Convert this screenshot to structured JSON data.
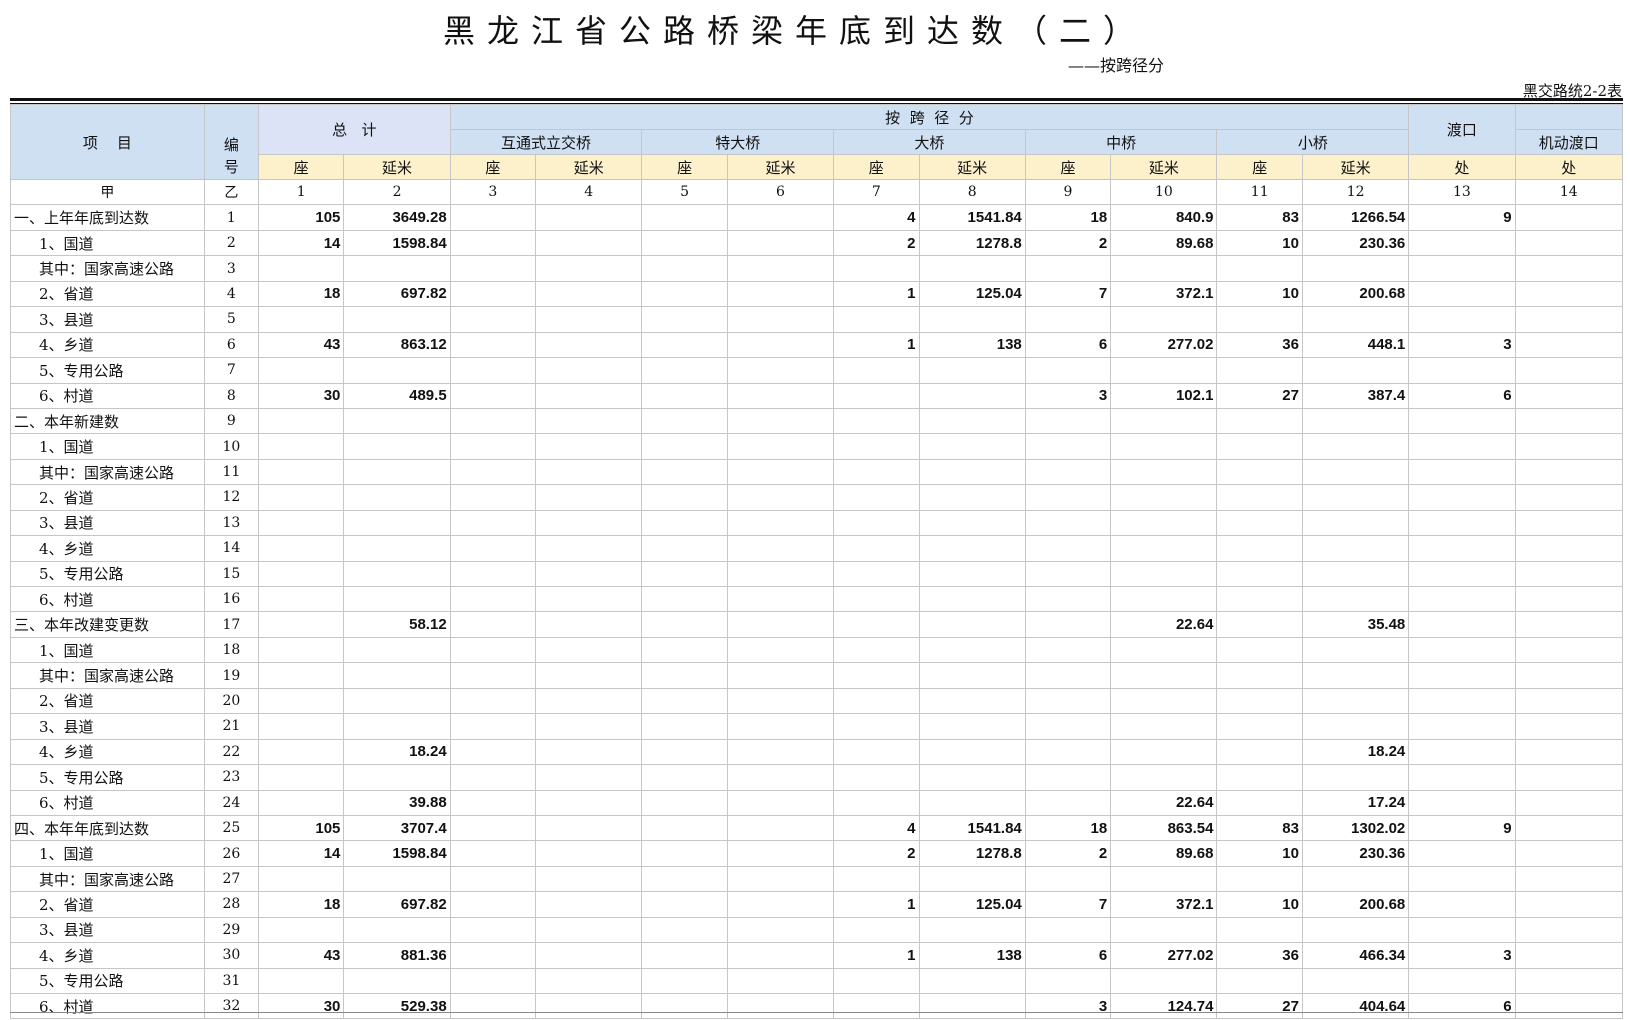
{
  "title": "黑龙江省公路桥梁年底到达数（二）",
  "subtitle": "——按跨径分",
  "form_no": "黑交路统2-2表",
  "header": {
    "item": "项    目",
    "code_top": "编",
    "code_bottom": "号",
    "total": "总   计",
    "by_span": "按  跨  径  分",
    "interchange": "互通式立交桥",
    "extra_large": "特大桥",
    "large": "大桥",
    "medium": "中桥",
    "small": "小桥",
    "ferry": "渡口",
    "motor_ferry": "机动渡口",
    "seat": "座",
    "meter": "延米",
    "place": "处",
    "col_a": "甲",
    "col_b": "乙",
    "col_nums": [
      "1",
      "2",
      "3",
      "4",
      "5",
      "6",
      "7",
      "8",
      "9",
      "10",
      "11",
      "12",
      "13",
      "14"
    ]
  },
  "rows": [
    {
      "name": "一、上年年底到达数",
      "code": "1",
      "sub": false,
      "values": [
        "105",
        "3649.28",
        "",
        "",
        "",
        "",
        "4",
        "1541.84",
        "18",
        "840.9",
        "83",
        "1266.54",
        "9",
        ""
      ]
    },
    {
      "name": "1、国道",
      "code": "2",
      "sub": true,
      "values": [
        "14",
        "1598.84",
        "",
        "",
        "",
        "",
        "2",
        "1278.8",
        "2",
        "89.68",
        "10",
        "230.36",
        "",
        ""
      ]
    },
    {
      "name": "其中：国家高速公路",
      "code": "3",
      "sub": true,
      "values": [
        "",
        "",
        "",
        "",
        "",
        "",
        "",
        "",
        "",
        "",
        "",
        "",
        "",
        ""
      ]
    },
    {
      "name": "2、省道",
      "code": "4",
      "sub": true,
      "values": [
        "18",
        "697.82",
        "",
        "",
        "",
        "",
        "1",
        "125.04",
        "7",
        "372.1",
        "10",
        "200.68",
        "",
        ""
      ]
    },
    {
      "name": "3、县道",
      "code": "5",
      "sub": true,
      "values": [
        "",
        "",
        "",
        "",
        "",
        "",
        "",
        "",
        "",
        "",
        "",
        "",
        "",
        ""
      ]
    },
    {
      "name": "4、乡道",
      "code": "6",
      "sub": true,
      "values": [
        "43",
        "863.12",
        "",
        "",
        "",
        "",
        "1",
        "138",
        "6",
        "277.02",
        "36",
        "448.1",
        "3",
        ""
      ]
    },
    {
      "name": "5、专用公路",
      "code": "7",
      "sub": true,
      "values": [
        "",
        "",
        "",
        "",
        "",
        "",
        "",
        "",
        "",
        "",
        "",
        "",
        "",
        ""
      ]
    },
    {
      "name": "6、村道",
      "code": "8",
      "sub": true,
      "values": [
        "30",
        "489.5",
        "",
        "",
        "",
        "",
        "",
        "",
        "3",
        "102.1",
        "27",
        "387.4",
        "6",
        ""
      ]
    },
    {
      "name": "二、本年新建数",
      "code": "9",
      "sub": false,
      "values": [
        "",
        "",
        "",
        "",
        "",
        "",
        "",
        "",
        "",
        "",
        "",
        "",
        "",
        ""
      ]
    },
    {
      "name": "1、国道",
      "code": "10",
      "sub": true,
      "values": [
        "",
        "",
        "",
        "",
        "",
        "",
        "",
        "",
        "",
        "",
        "",
        "",
        "",
        ""
      ]
    },
    {
      "name": "其中：国家高速公路",
      "code": "11",
      "sub": true,
      "values": [
        "",
        "",
        "",
        "",
        "",
        "",
        "",
        "",
        "",
        "",
        "",
        "",
        "",
        ""
      ]
    },
    {
      "name": "2、省道",
      "code": "12",
      "sub": true,
      "values": [
        "",
        "",
        "",
        "",
        "",
        "",
        "",
        "",
        "",
        "",
        "",
        "",
        "",
        ""
      ]
    },
    {
      "name": "3、县道",
      "code": "13",
      "sub": true,
      "values": [
        "",
        "",
        "",
        "",
        "",
        "",
        "",
        "",
        "",
        "",
        "",
        "",
        "",
        ""
      ]
    },
    {
      "name": "4、乡道",
      "code": "14",
      "sub": true,
      "values": [
        "",
        "",
        "",
        "",
        "",
        "",
        "",
        "",
        "",
        "",
        "",
        "",
        "",
        ""
      ]
    },
    {
      "name": "5、专用公路",
      "code": "15",
      "sub": true,
      "values": [
        "",
        "",
        "",
        "",
        "",
        "",
        "",
        "",
        "",
        "",
        "",
        "",
        "",
        ""
      ]
    },
    {
      "name": "6、村道",
      "code": "16",
      "sub": true,
      "values": [
        "",
        "",
        "",
        "",
        "",
        "",
        "",
        "",
        "",
        "",
        "",
        "",
        "",
        ""
      ]
    },
    {
      "name": "三、本年改建变更数",
      "code": "17",
      "sub": false,
      "values": [
        "",
        "58.12",
        "",
        "",
        "",
        "",
        "",
        "",
        "",
        "22.64",
        "",
        "35.48",
        "",
        ""
      ]
    },
    {
      "name": "1、国道",
      "code": "18",
      "sub": true,
      "values": [
        "",
        "",
        "",
        "",
        "",
        "",
        "",
        "",
        "",
        "",
        "",
        "",
        "",
        ""
      ]
    },
    {
      "name": "其中：国家高速公路",
      "code": "19",
      "sub": true,
      "values": [
        "",
        "",
        "",
        "",
        "",
        "",
        "",
        "",
        "",
        "",
        "",
        "",
        "",
        ""
      ]
    },
    {
      "name": "2、省道",
      "code": "20",
      "sub": true,
      "values": [
        "",
        "",
        "",
        "",
        "",
        "",
        "",
        "",
        "",
        "",
        "",
        "",
        "",
        ""
      ]
    },
    {
      "name": "3、县道",
      "code": "21",
      "sub": true,
      "values": [
        "",
        "",
        "",
        "",
        "",
        "",
        "",
        "",
        "",
        "",
        "",
        "",
        "",
        ""
      ]
    },
    {
      "name": "4、乡道",
      "code": "22",
      "sub": true,
      "values": [
        "",
        "18.24",
        "",
        "",
        "",
        "",
        "",
        "",
        "",
        "",
        "",
        "18.24",
        "",
        ""
      ]
    },
    {
      "name": "5、专用公路",
      "code": "23",
      "sub": true,
      "values": [
        "",
        "",
        "",
        "",
        "",
        "",
        "",
        "",
        "",
        "",
        "",
        "",
        "",
        ""
      ]
    },
    {
      "name": "6、村道",
      "code": "24",
      "sub": true,
      "values": [
        "",
        "39.88",
        "",
        "",
        "",
        "",
        "",
        "",
        "",
        "22.64",
        "",
        "17.24",
        "",
        ""
      ]
    },
    {
      "name": "四、本年年底到达数",
      "code": "25",
      "sub": false,
      "values": [
        "105",
        "3707.4",
        "",
        "",
        "",
        "",
        "4",
        "1541.84",
        "18",
        "863.54",
        "83",
        "1302.02",
        "9",
        ""
      ]
    },
    {
      "name": "1、国道",
      "code": "26",
      "sub": true,
      "values": [
        "14",
        "1598.84",
        "",
        "",
        "",
        "",
        "2",
        "1278.8",
        "2",
        "89.68",
        "10",
        "230.36",
        "",
        ""
      ]
    },
    {
      "name": "其中：国家高速公路",
      "code": "27",
      "sub": true,
      "values": [
        "",
        "",
        "",
        "",
        "",
        "",
        "",
        "",
        "",
        "",
        "",
        "",
        "",
        ""
      ]
    },
    {
      "name": "2、省道",
      "code": "28",
      "sub": true,
      "values": [
        "18",
        "697.82",
        "",
        "",
        "",
        "",
        "1",
        "125.04",
        "7",
        "372.1",
        "10",
        "200.68",
        "",
        ""
      ]
    },
    {
      "name": "3、县道",
      "code": "29",
      "sub": true,
      "values": [
        "",
        "",
        "",
        "",
        "",
        "",
        "",
        "",
        "",
        "",
        "",
        "",
        "",
        ""
      ]
    },
    {
      "name": "4、乡道",
      "code": "30",
      "sub": true,
      "values": [
        "43",
        "881.36",
        "",
        "",
        "",
        "",
        "1",
        "138",
        "6",
        "277.02",
        "36",
        "466.34",
        "3",
        ""
      ]
    },
    {
      "name": "5、专用公路",
      "code": "31",
      "sub": true,
      "values": [
        "",
        "",
        "",
        "",
        "",
        "",
        "",
        "",
        "",
        "",
        "",
        "",
        "",
        ""
      ]
    },
    {
      "name": "6、村道",
      "code": "32",
      "sub": true,
      "values": [
        "30",
        "529.38",
        "",
        "",
        "",
        "",
        "",
        "",
        "3",
        "124.74",
        "27",
        "404.64",
        "6",
        ""
      ]
    }
  ]
}
